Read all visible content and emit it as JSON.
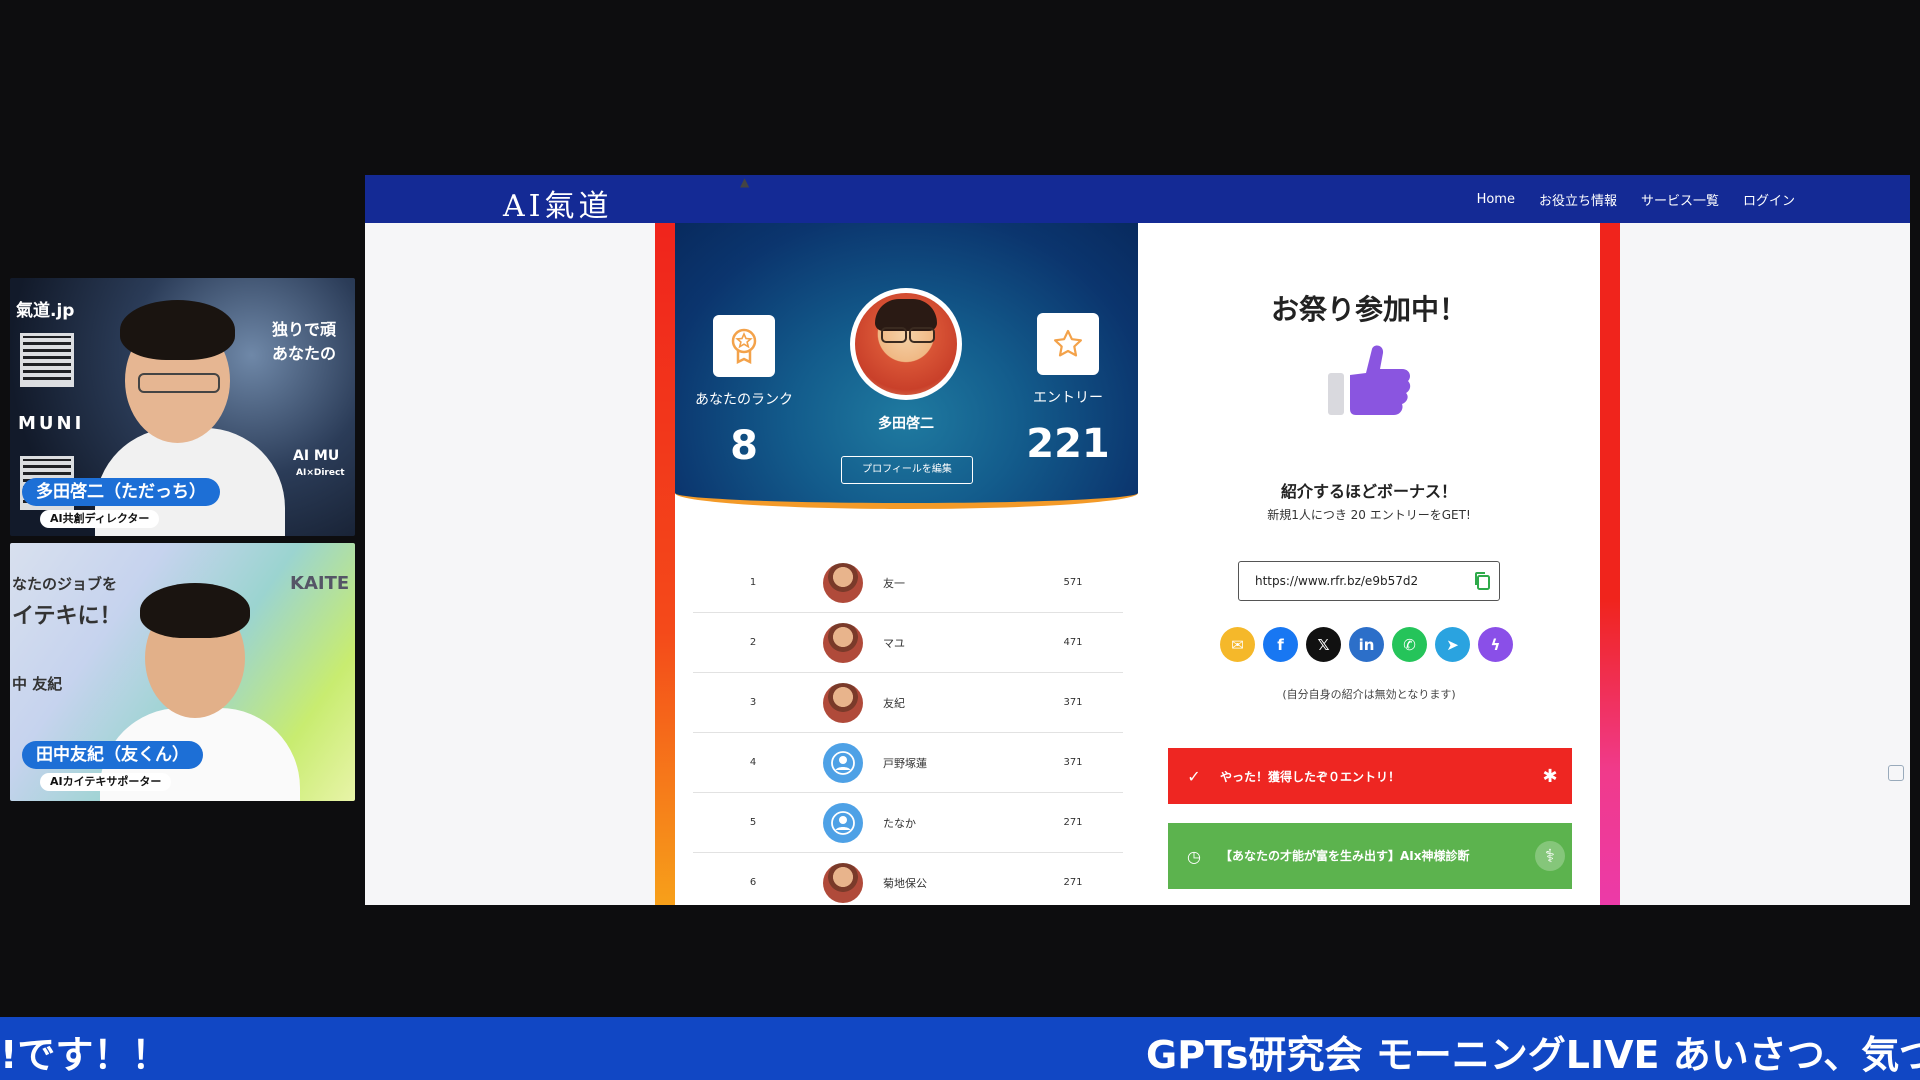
{
  "participants": [
    {
      "name": "多田啓二（ただっち）",
      "role": "AI共創ディレクター",
      "background_text": [
        "氣道.jp",
        "独りで頑",
        "あなたの",
        "MUNI",
        "AI MU",
        "AI×Direct"
      ]
    },
    {
      "name": "田中友紀（友くん）",
      "role": "AIカイテキサポーター",
      "background_text": [
        "なたのジョブを",
        "イテキに！",
        "KAITE",
        "中 友紀"
      ]
    }
  ],
  "site": {
    "logo": "AI氣道",
    "nav": [
      "Home",
      "お役立ち情報",
      "サービス一覧",
      "ログイン"
    ]
  },
  "profile": {
    "rank_label": "あなたのランク",
    "rank_value": "8",
    "entry_label": "エントリー",
    "entry_value": "221",
    "name": "多田啓二",
    "edit_button": "プロフィールを編集"
  },
  "leaderboard": [
    {
      "rank": "1",
      "name": "友一",
      "points": "571",
      "avatar": "photo"
    },
    {
      "rank": "2",
      "name": "マユ",
      "points": "471",
      "avatar": "photo"
    },
    {
      "rank": "3",
      "name": "友紀",
      "points": "371",
      "avatar": "photo"
    },
    {
      "rank": "4",
      "name": "戸野塚蓮",
      "points": "371",
      "avatar": "placeholder"
    },
    {
      "rank": "5",
      "name": "たなか",
      "points": "271",
      "avatar": "placeholder"
    },
    {
      "rank": "6",
      "name": "菊地保公",
      "points": "271",
      "avatar": "photo"
    }
  ],
  "festival": {
    "title": "お祭り参加中！",
    "bonus_title": "紹介するほどボーナス！",
    "bonus_sub": "新規1人につき 20 エントリーをGET!",
    "referral_url": "https://www.rfr.bz/e9b57d2",
    "share_note": "(自分自身の紹介は無効となります)",
    "share": [
      {
        "name": "email",
        "glyph": "✉",
        "color": "#f5b82a"
      },
      {
        "name": "facebook",
        "glyph": "f",
        "color": "#1877f2"
      },
      {
        "name": "x",
        "glyph": "𝕏",
        "color": "#111111"
      },
      {
        "name": "linkedin",
        "glyph": "in",
        "color": "#2c6fc9"
      },
      {
        "name": "whatsapp",
        "glyph": "✆",
        "color": "#25c45a"
      },
      {
        "name": "telegram",
        "glyph": "➤",
        "color": "#2aa3e0"
      },
      {
        "name": "messenger",
        "glyph": "ϟ",
        "color": "#8a4fe8"
      }
    ],
    "action_done": "やった！獲得したぞ０エントリ！",
    "action_task": "【あなたの才能が富を生み出す】AIx神様診断"
  },
  "ticker": {
    "left": "!です！！",
    "right": "GPTs研究会 モーニングLIVE あいさつ、気づ"
  },
  "colors": {
    "header": "#142a95",
    "accent_red": "#ee2622",
    "accent_green": "#5cb34e",
    "thumb": "#8a55e0",
    "ticker": "#1147c4"
  }
}
